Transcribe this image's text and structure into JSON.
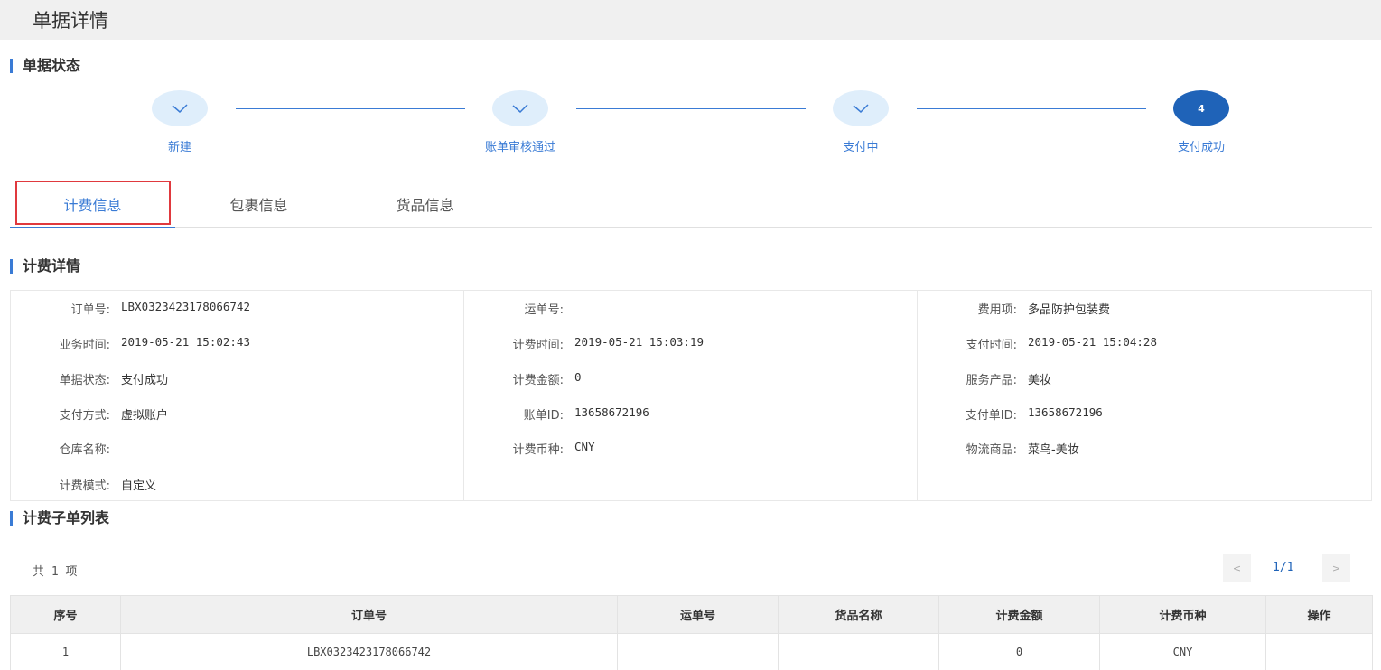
{
  "page": {
    "title": "单据详情"
  },
  "status_section": {
    "title": "单据状态"
  },
  "steps": [
    {
      "label": "新建",
      "state": "done",
      "icon": "check-icon"
    },
    {
      "label": "账单审核通过",
      "state": "done",
      "icon": "check-icon"
    },
    {
      "label": "支付中",
      "state": "done",
      "icon": "check-icon"
    },
    {
      "label": "支付成功",
      "state": "active",
      "number": "4"
    }
  ],
  "tabs": [
    {
      "label": "计费信息",
      "active": true
    },
    {
      "label": "包裹信息",
      "active": false
    },
    {
      "label": "货品信息",
      "active": false
    }
  ],
  "detail_section": {
    "title": "计费详情"
  },
  "details": {
    "col1": [
      {
        "label": "订单号:",
        "value": "LBX0323423178066742"
      },
      {
        "label": "业务时间:",
        "value": "2019-05-21 15:02:43"
      },
      {
        "label": "单据状态:",
        "value": "支付成功"
      },
      {
        "label": "支付方式:",
        "value": "虚拟账户"
      },
      {
        "label": "仓库名称:",
        "value": ""
      },
      {
        "label": "计费模式:",
        "value": "自定义"
      }
    ],
    "col2": [
      {
        "label": "运单号:",
        "value": ""
      },
      {
        "label": "计费时间:",
        "value": "2019-05-21 15:03:19"
      },
      {
        "label": "计费金额:",
        "value": "0"
      },
      {
        "label": "账单ID:",
        "value": "13658672196"
      },
      {
        "label": "计费币种:",
        "value": "CNY"
      }
    ],
    "col3": [
      {
        "label": "费用项:",
        "value": "多品防护包装费"
      },
      {
        "label": "支付时间:",
        "value": "2019-05-21 15:04:28"
      },
      {
        "label": "服务产品:",
        "value": "美妆"
      },
      {
        "label": "支付单ID:",
        "value": "13658672196"
      },
      {
        "label": "物流商品:",
        "value": "菜鸟-美妆"
      }
    ]
  },
  "list_section": {
    "title": "计费子单列表"
  },
  "list": {
    "total": "共 1 项",
    "pager": {
      "prev": "<",
      "page": "1/1",
      "next": ">"
    },
    "columns": [
      "序号",
      "订单号",
      "运单号",
      "货品名称",
      "计费金额",
      "计费币种",
      "操作"
    ],
    "rows": [
      [
        "1",
        "LBX0323423178066742",
        "",
        "",
        "0",
        "CNY",
        ""
      ]
    ]
  },
  "colors": {
    "accent": "#3a7bd5",
    "active_step": "#1f63b8",
    "highlight": "#e0393e"
  }
}
